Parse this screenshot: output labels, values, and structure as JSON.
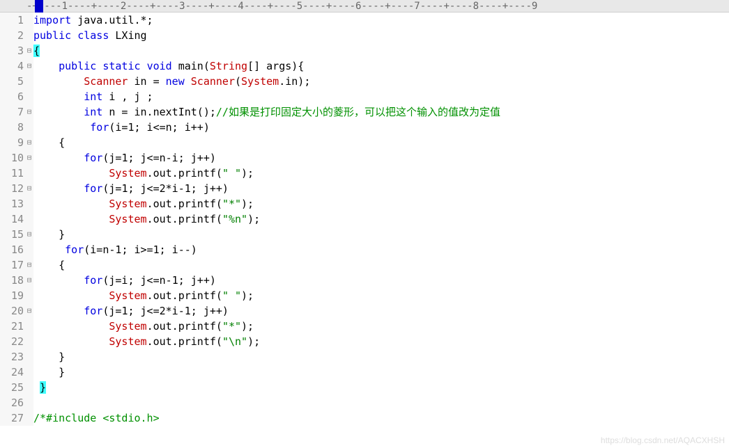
{
  "ruler": "-+----1----+----2----+----3----+----4----+----5----+----6----+----7----+----8----+----9",
  "watermark": "https://blog.csdn.net/AQACXHSH",
  "gutter": [
    "1",
    "2",
    "3",
    "4",
    "5",
    "6",
    "7",
    "8",
    "9",
    "10",
    "11",
    "12",
    "13",
    "14",
    "15",
    "16",
    "17",
    "18",
    "19",
    "20",
    "21",
    "22",
    "23",
    "24",
    "25",
    "26",
    "27"
  ],
  "fold": [
    "",
    "",
    "⊟",
    "⊟",
    "",
    "",
    "⊟",
    "",
    "⊟",
    "⊟",
    "",
    "⊟",
    "",
    "",
    "⊟",
    "",
    "⊟",
    "⊟",
    "",
    "⊟",
    "",
    "",
    "",
    "",
    "",
    "",
    ""
  ],
  "lines": {
    "l1": {
      "kw1": "import",
      "plain1": " java.util.*;"
    },
    "l2": {
      "kw1": "public",
      "kw2": "class",
      "plain1": " LXing"
    },
    "l3": {
      "brace": "{"
    },
    "l4": {
      "kw1": "public",
      "kw2": "static",
      "kw3": "void",
      "plain1": " main(",
      "type1": "String",
      "plain2": "[] args){"
    },
    "l5": {
      "type1": "Scanner",
      "plain1": " in = ",
      "kw1": "new",
      "plain2": " ",
      "type2": "Scanner",
      "plain3": "(",
      "type3": "System",
      "plain4": ".in);"
    },
    "l6": {
      "kw1": "int",
      "plain1": " i , j ;"
    },
    "l7": {
      "kw1": "int",
      "plain1": " n = in.nextInt();",
      "cmt": "//如果是打印固定大小的菱形，可以把这个输入的值改为定值"
    },
    "l8": {
      "kw1": "for",
      "plain1": "(i=",
      "num1": "1",
      "plain2": "; i<=n; i++)"
    },
    "l9": {
      "plain1": "{"
    },
    "l10": {
      "kw1": "for",
      "plain1": "(j=",
      "num1": "1",
      "plain2": "; j<=n-i; j++)"
    },
    "l11": {
      "type1": "System",
      "plain1": ".out.printf(",
      "str1": "\" \"",
      "plain2": ");"
    },
    "l12": {
      "kw1": "for",
      "plain1": "(j=",
      "num1": "1",
      "plain2": "; j<=",
      "num2": "2",
      "plain3": "*i-",
      "num3": "1",
      "plain4": "; j++)"
    },
    "l13": {
      "type1": "System",
      "plain1": ".out.printf(",
      "str1": "\"*\"",
      "plain2": ");"
    },
    "l14": {
      "type1": "System",
      "plain1": ".out.printf(",
      "str1": "\"%n\"",
      "plain2": ");"
    },
    "l15": {
      "plain1": "}"
    },
    "l16": {
      "kw1": "for",
      "plain1": "(i=n-",
      "num1": "1",
      "plain2": "; i>=",
      "num2": "1",
      "plain3": "; i--)"
    },
    "l17": {
      "plain1": "{"
    },
    "l18": {
      "kw1": "for",
      "plain1": "(j=i; j<=n-",
      "num1": "1",
      "plain2": "; j++)"
    },
    "l19": {
      "type1": "System",
      "plain1": ".out.printf(",
      "str1": "\" \"",
      "plain2": ");"
    },
    "l20": {
      "kw1": "for",
      "plain1": "(j=",
      "num1": "1",
      "plain2": "; j<=",
      "num2": "2",
      "plain3": "*i-",
      "num3": "1",
      "plain4": "; j++)"
    },
    "l21": {
      "type1": "System",
      "plain1": ".out.printf(",
      "str1": "\"*\"",
      "plain2": ");"
    },
    "l22": {
      "type1": "System",
      "plain1": ".out.printf(",
      "str1": "\"\\n\"",
      "plain2": ");"
    },
    "l23": {
      "plain1": "}"
    },
    "l24": {
      "plain1": "}"
    },
    "l25": {
      "brace": "}"
    },
    "l26": {
      "plain1": ""
    },
    "l27": {
      "cmt": "/*#include <stdio.h>"
    }
  }
}
